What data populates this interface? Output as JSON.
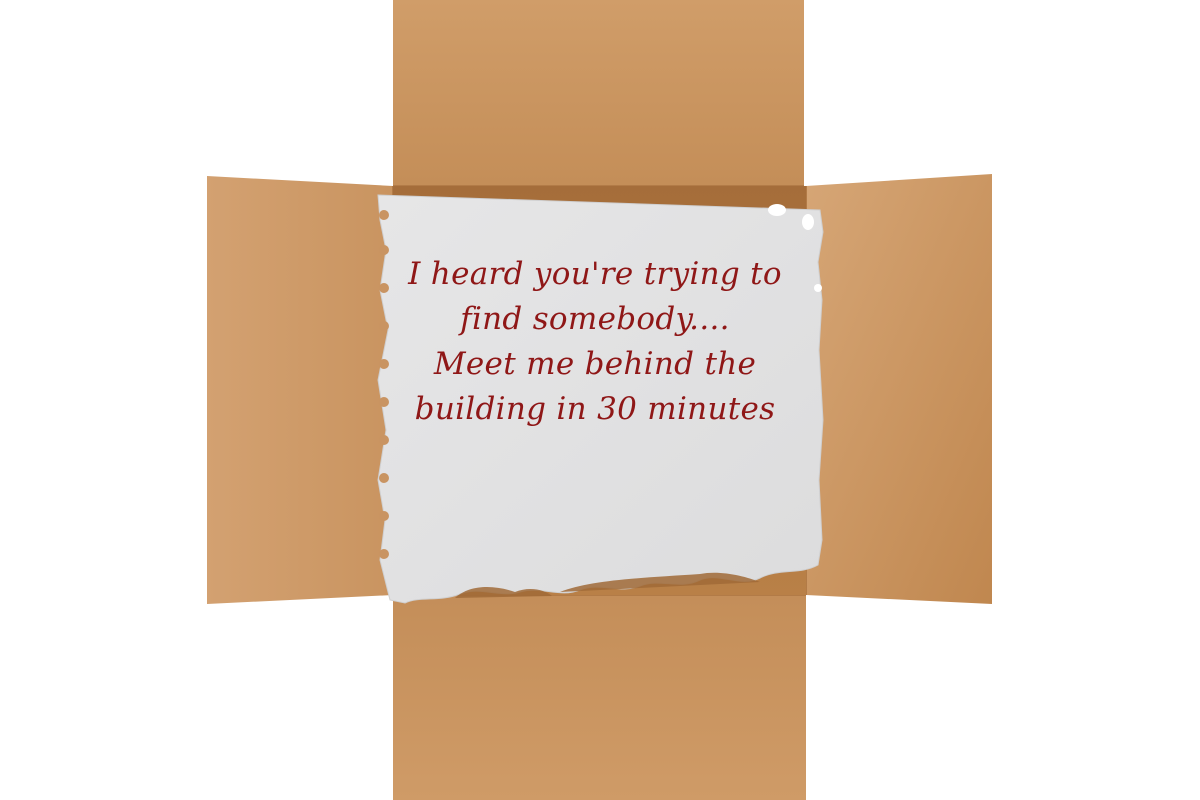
{
  "note": {
    "lines": [
      "I heard you're trying to",
      "find somebody....",
      "Meet me behind the",
      "building in 30 minutes"
    ]
  },
  "colors": {
    "background": "#ffffff",
    "cardboard": "#c8935e",
    "cardboard_light": "#d6a777",
    "cardboard_dark": "#b77f4b",
    "paper": "#e3e3e4",
    "ink": "#8f1717"
  }
}
